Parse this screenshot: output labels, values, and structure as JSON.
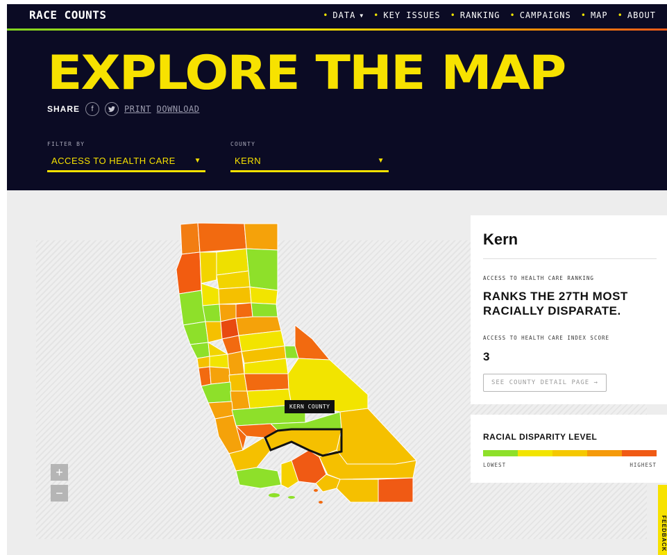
{
  "header": {
    "logo": "RACE COUNTS",
    "nav": [
      {
        "label": "DATA",
        "has_caret": true
      },
      {
        "label": "KEY ISSUES"
      },
      {
        "label": "RANKING"
      },
      {
        "label": "CAMPAIGNS"
      },
      {
        "label": "MAP"
      },
      {
        "label": "ABOUT"
      }
    ],
    "title": "EXPLORE THE MAP",
    "share_label": "SHARE",
    "print_label": "PRINT",
    "download_label": "DOWNLOAD",
    "social": [
      "facebook-icon",
      "twitter-icon"
    ]
  },
  "filters": {
    "filter_by_label": "FILTER BY",
    "filter_by_value": "ACCESS TO HEALTH CARE",
    "county_label": "COUNTY",
    "county_value": "KERN"
  },
  "map": {
    "tooltip": "KERN COUNTY",
    "zoom_in": "+",
    "zoom_out": "−"
  },
  "panel": {
    "county": "Kern",
    "ranking_label": "ACCESS TO HEALTH CARE RANKING",
    "rank_text": "RANKS THE 27TH MOST RACIALLY DISPARATE.",
    "score_label": "ACCESS TO HEALTH CARE INDEX SCORE",
    "score": "3",
    "detail_button": "SEE COUNTY DETAIL PAGE →"
  },
  "legend": {
    "title": "RACIAL DISPARITY LEVEL",
    "low": "LOWEST",
    "high": "HIGHEST",
    "colors": [
      "#8ee02a",
      "#f2e400",
      "#f5c800",
      "#f59a0a",
      "#f05a14"
    ]
  },
  "side_tab": "FEEDBACK",
  "colors": {
    "header_bg": "#0b0b24",
    "accent_yellow": "#f7e200"
  }
}
